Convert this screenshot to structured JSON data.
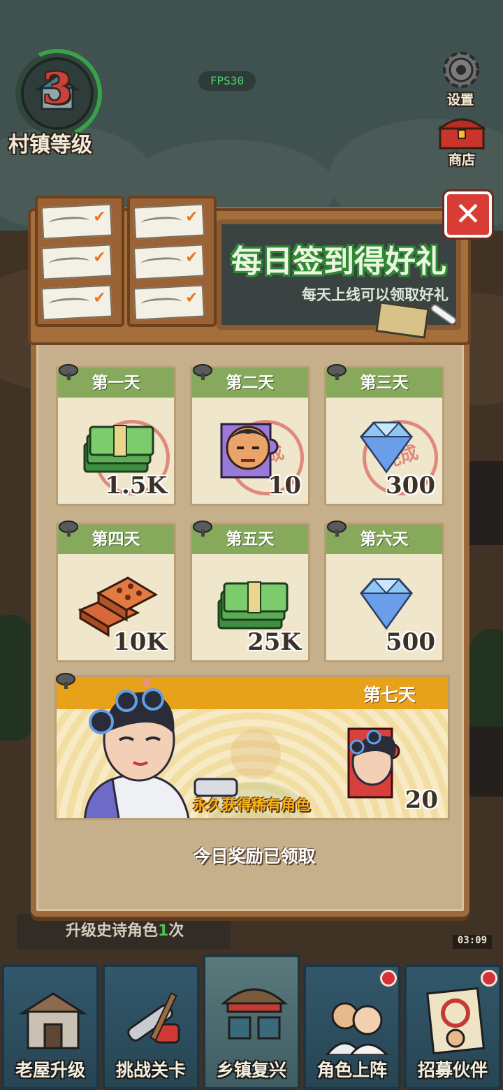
{
  "hud": {
    "village_level": "3",
    "village_level_label": "村镇等级",
    "fps": "FPS30",
    "settings_label": "设置",
    "shop_label": "商店",
    "task_text_before": "升级史诗角色",
    "task_highlight": "1",
    "task_text_after": "次",
    "timer": "03:09"
  },
  "dialog": {
    "title": "每日签到得好礼",
    "subtitle": "每天上线可以领取好礼",
    "close_symbol": "✕",
    "stamp_text": "完成",
    "days": [
      {
        "label": "第一天",
        "amount": "1.5K",
        "item": "cash-icon",
        "claimed": true
      },
      {
        "label": "第二天",
        "amount": "10",
        "item": "character-fragment-icon",
        "claimed": true
      },
      {
        "label": "第三天",
        "amount": "300",
        "item": "diamond-icon",
        "claimed": true
      },
      {
        "label": "第四天",
        "amount": "10K",
        "item": "brick-icon",
        "claimed": false
      },
      {
        "label": "第五天",
        "amount": "25K",
        "item": "cash-icon",
        "claimed": false
      },
      {
        "label": "第六天",
        "amount": "500",
        "item": "diamond-icon",
        "claimed": false
      }
    ],
    "day7": {
      "label": "第七天",
      "caption": "永久获得稀有角色",
      "amount": "20",
      "item": "rare-character-fragment-icon"
    },
    "status": "今日奖励已领取"
  },
  "nav": [
    {
      "label": "老屋升级",
      "icon": "old-house-icon",
      "badge": false
    },
    {
      "label": "挑战关卡",
      "icon": "chainsaw-shovel-icon",
      "badge": false
    },
    {
      "label": "乡镇复兴",
      "icon": "market-stall-icon",
      "badge": false,
      "active": true
    },
    {
      "label": "角色上阵",
      "icon": "characters-icon",
      "badge": true
    },
    {
      "label": "招募伙伴",
      "icon": "recruit-poster-icon",
      "badge": true
    }
  ],
  "colors": {
    "green_header": "#86a95b",
    "title_outline": "#2f8a32",
    "gold_band": "#e8a21a",
    "close_red": "#d93b35"
  }
}
